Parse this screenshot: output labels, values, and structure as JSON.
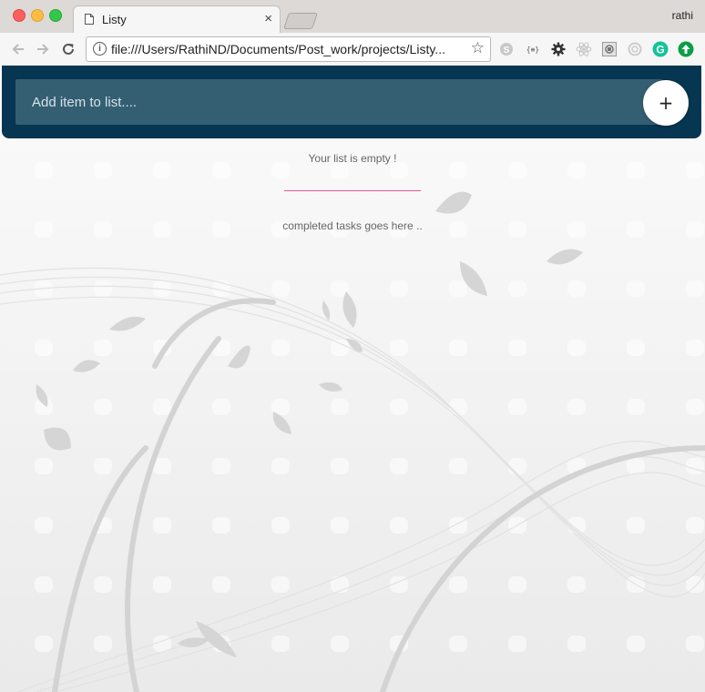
{
  "browser": {
    "tab_title": "Listy",
    "tab_close": "×",
    "profile_name": "rathi",
    "url": "file:///Users/RathiND/Documents/Post_work/projects/Listy...",
    "extensions": [
      "skype-icon",
      "json-formatter-icon",
      "gear-icon",
      "react-icon",
      "grid-extension-icon",
      "circle-extension-icon",
      "grammarly-icon",
      "upload-icon"
    ]
  },
  "app": {
    "input_placeholder": "Add item to list....",
    "add_button_label": "+",
    "empty_message": "Your list is empty !",
    "completed_message": "completed tasks goes here .."
  },
  "colors": {
    "header": "#063651",
    "input": "#345f72",
    "divider": "#e0539d",
    "grammarly": "#15c39a",
    "upload": "#0a9e46"
  }
}
